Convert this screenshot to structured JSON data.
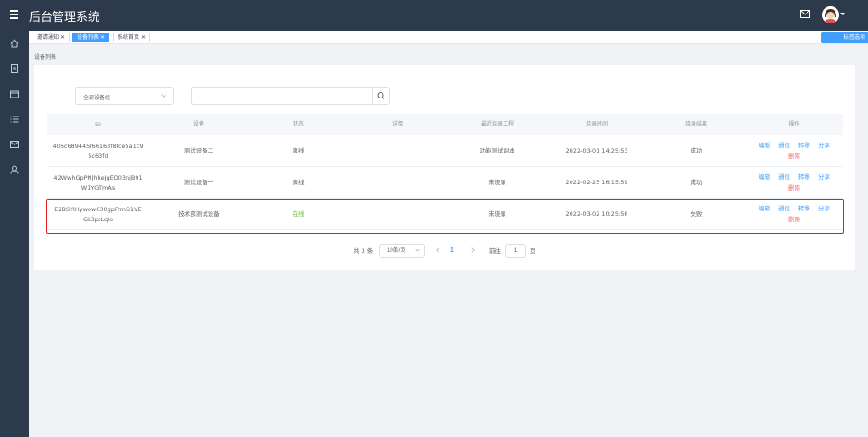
{
  "header": {
    "title": "后台管理系统",
    "menu_icon": "hamburger-icon",
    "mail_icon": "mail-icon"
  },
  "sidebar": {
    "icons": [
      "home-icon",
      "document-icon",
      "folder-icon",
      "list-icon",
      "message-icon",
      "user-icon"
    ]
  },
  "tags": [
    {
      "label": "邀请通知",
      "active": false
    },
    {
      "label": "设备列表",
      "active": true
    },
    {
      "label": "系统首页",
      "active": false
    }
  ],
  "tags_ops_label": "标签选项",
  "breadcrumb": "设备列表",
  "filter": {
    "group_select": "全部设备组",
    "search_placeholder": ""
  },
  "table": {
    "columns": [
      "sn",
      "设备",
      "状态",
      "详情",
      "最近烧录工程",
      "烧录时间",
      "烧录结果",
      "操作"
    ],
    "rows": [
      {
        "sn": "406c689445f66163f8fce5a1c95c63fd",
        "device": "测试设备二",
        "status": "离线",
        "detail": "",
        "project": "功能测试副本",
        "time": "2022-03-01 14:25:53",
        "result": "成功"
      },
      {
        "sn": "42WwhGpPNJhheJgED03njB91W1YGTmAs",
        "device": "测试设备一",
        "status": "离线",
        "detail": "",
        "project": "未烧录",
        "time": "2022-02-25 16:15:59",
        "result": "成功"
      },
      {
        "sn": "E2BSYIHywow030gpFrmG1VEGL3ptLqIo",
        "device": "技术部测试设备",
        "status": "在线",
        "detail": "",
        "project": "未烧录",
        "time": "2022-03-02 10:25:56",
        "result": "失败"
      }
    ],
    "actions": {
      "edit": "编辑",
      "comm": "通信",
      "move": "转移",
      "share": "分享",
      "delete": "删除"
    }
  },
  "pagination": {
    "total": "共 3 条",
    "page_size": "10条/页",
    "current": "1",
    "goto_label": "前往",
    "goto_value": "1",
    "page_unit": "页"
  },
  "colors": {
    "accent": "#409eff",
    "sidebar": "#2d3a4b",
    "online": "#67c23a",
    "danger": "#f56c6c",
    "highlight": "#e02020"
  }
}
